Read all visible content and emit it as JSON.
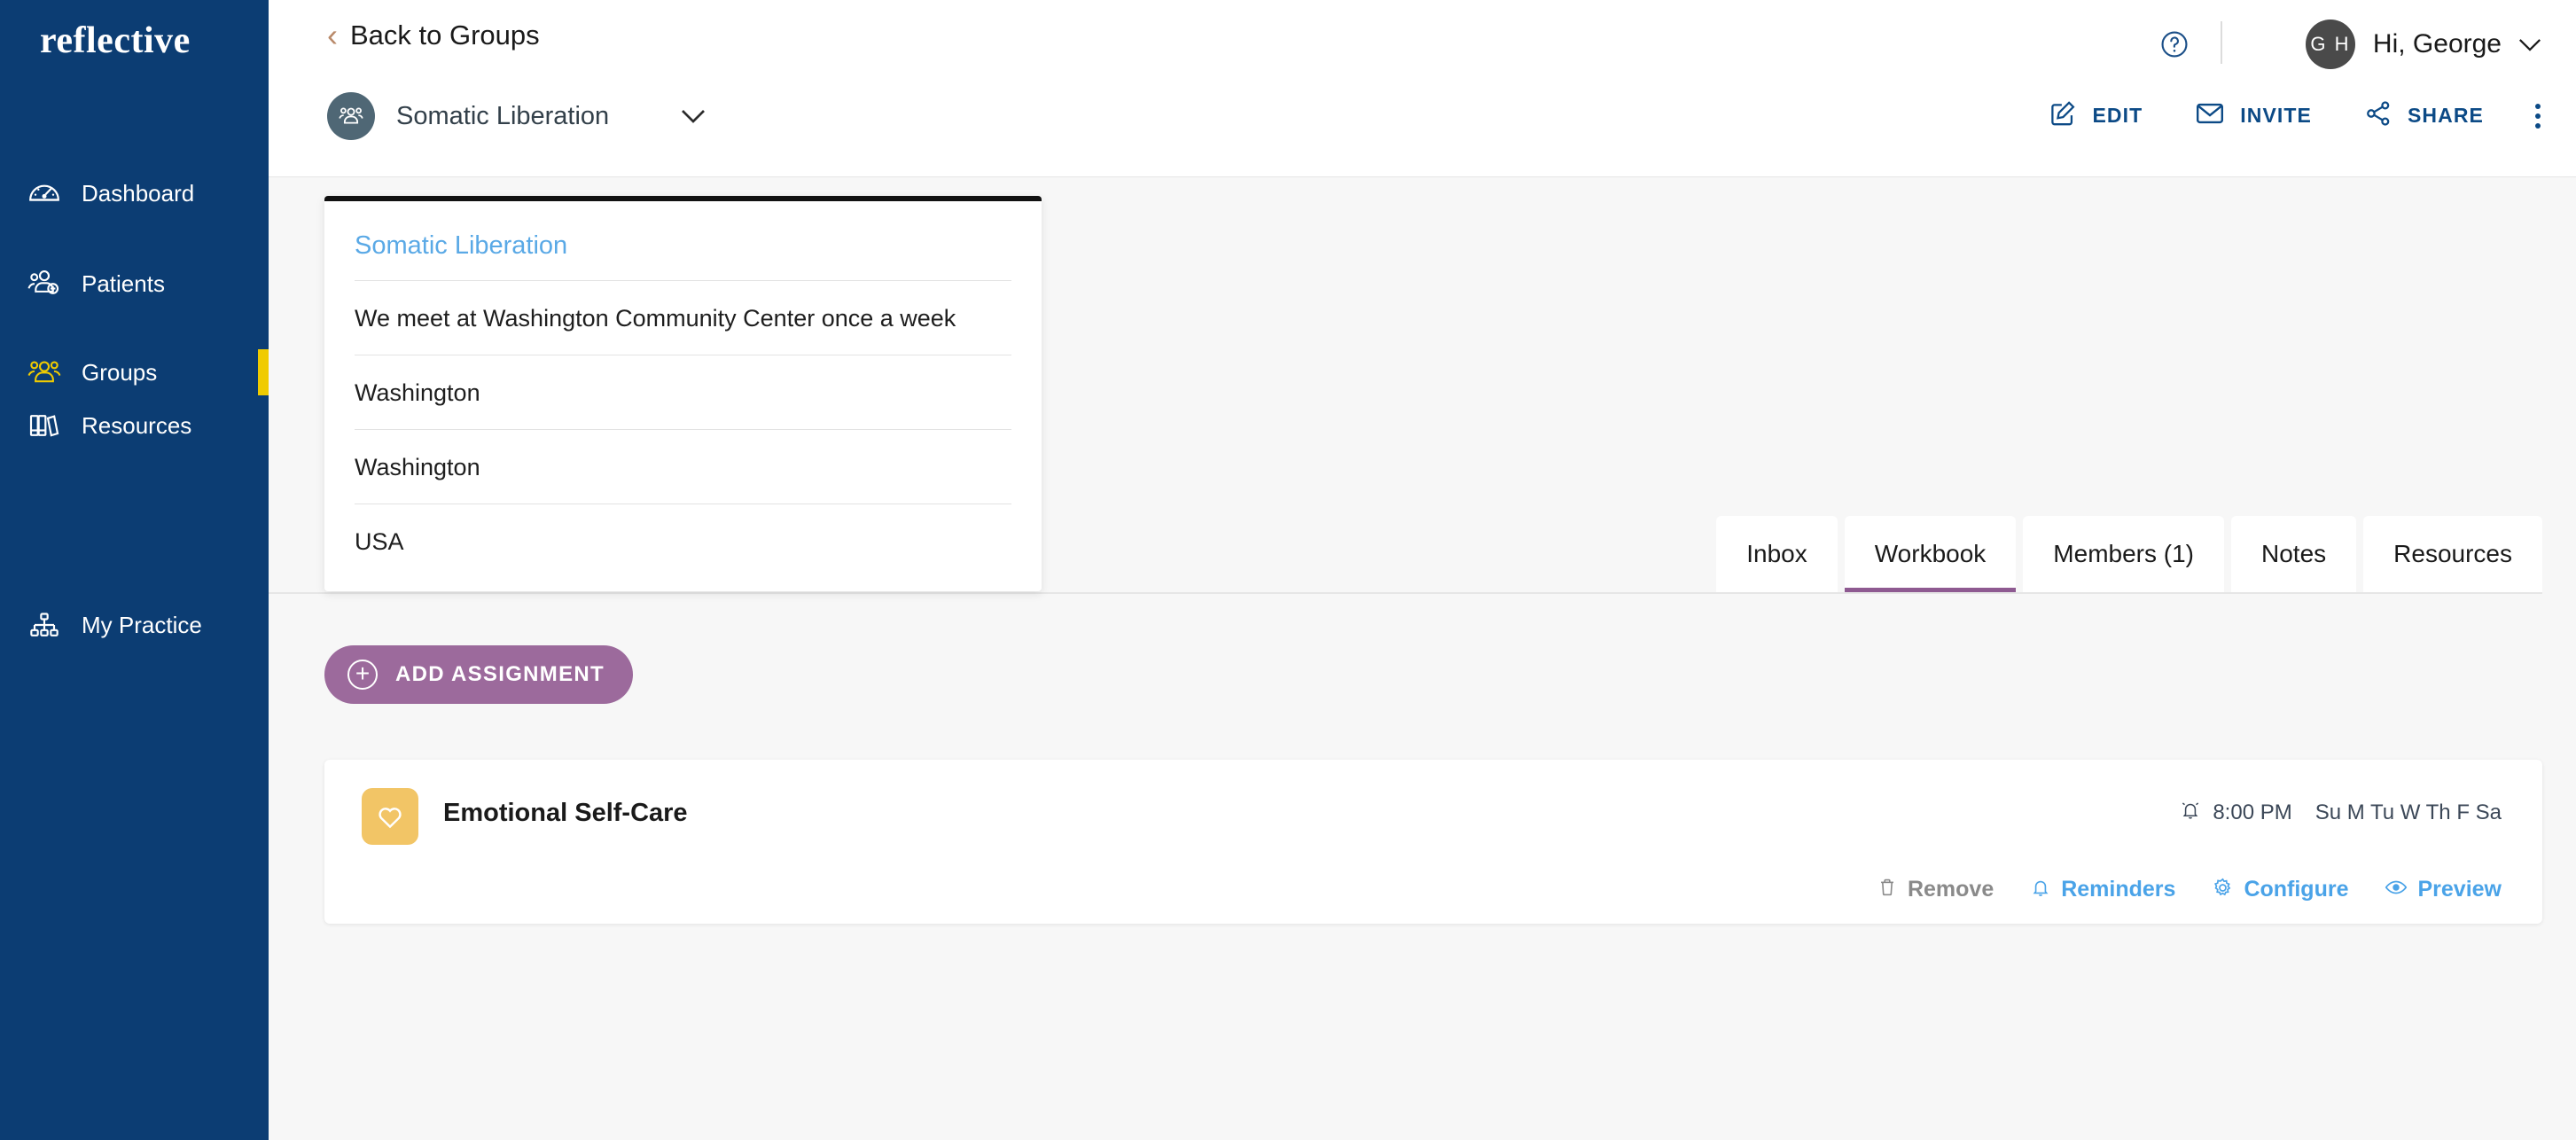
{
  "brand": {
    "logo_text": "reflective",
    "sidebar_bg": "#0c3d73",
    "active_indicator": "#f0cb00"
  },
  "sidebar": {
    "items": [
      {
        "label": "Dashboard",
        "icon": "speedometer-icon",
        "active": false
      },
      {
        "label": "Patients",
        "icon": "people-add-icon",
        "active": false
      },
      {
        "label": "Groups",
        "icon": "people-group-icon",
        "active": true
      },
      {
        "label": "Resources",
        "icon": "books-icon",
        "active": false
      },
      {
        "label": "My Practice",
        "icon": "org-chart-icon",
        "active": false
      }
    ]
  },
  "header": {
    "back_label": "Back to Groups",
    "back_icon": "chevron-left-icon",
    "group_name": "Somatic Liberation",
    "group_avatar_icon": "people-group-icon",
    "group_chevron_icon": "chevron-down-icon",
    "help_icon": "question-circle-icon",
    "user": {
      "initials": "G H",
      "greeting": "Hi, George",
      "chevron_icon": "chevron-down-icon"
    },
    "actions": [
      {
        "label": "EDIT",
        "icon": "pencil-square-icon"
      },
      {
        "label": "INVITE",
        "icon": "envelope-icon"
      },
      {
        "label": "SHARE",
        "icon": "share-nodes-icon"
      }
    ],
    "overflow_icon": "kebab-menu-icon",
    "action_color": "#0c4a86"
  },
  "group_panel": {
    "title": "Somatic Liberation",
    "rows": [
      "We meet at Washington Community Center once a week",
      "Washington",
      "Washington",
      "USA"
    ]
  },
  "tabs": [
    {
      "label": "Inbox",
      "active": false
    },
    {
      "label": "Workbook",
      "active": true
    },
    {
      "label": "Members (1)",
      "active": false
    },
    {
      "label": "Notes",
      "active": false
    },
    {
      "label": "Resources",
      "active": false
    }
  ],
  "tab_accent": "#8e5a91",
  "add_assignment": {
    "label": "ADD ASSIGNMENT",
    "icon": "plus-circle-icon",
    "color": "#9c6a9c"
  },
  "assignment": {
    "title": "Emotional Self-Care",
    "icon": "heart-icon",
    "icon_tile_color": "#f2c566",
    "reminder_icon": "alarm-bell-icon",
    "time": "8:00 PM",
    "days": "Su M Tu W Th F Sa",
    "actions": [
      {
        "label": "Remove",
        "icon": "trash-icon",
        "style": "muted"
      },
      {
        "label": "Reminders",
        "icon": "bell-icon",
        "style": "link"
      },
      {
        "label": "Configure",
        "icon": "gear-icon",
        "style": "link"
      },
      {
        "label": "Preview",
        "icon": "eye-icon",
        "style": "link"
      }
    ]
  }
}
